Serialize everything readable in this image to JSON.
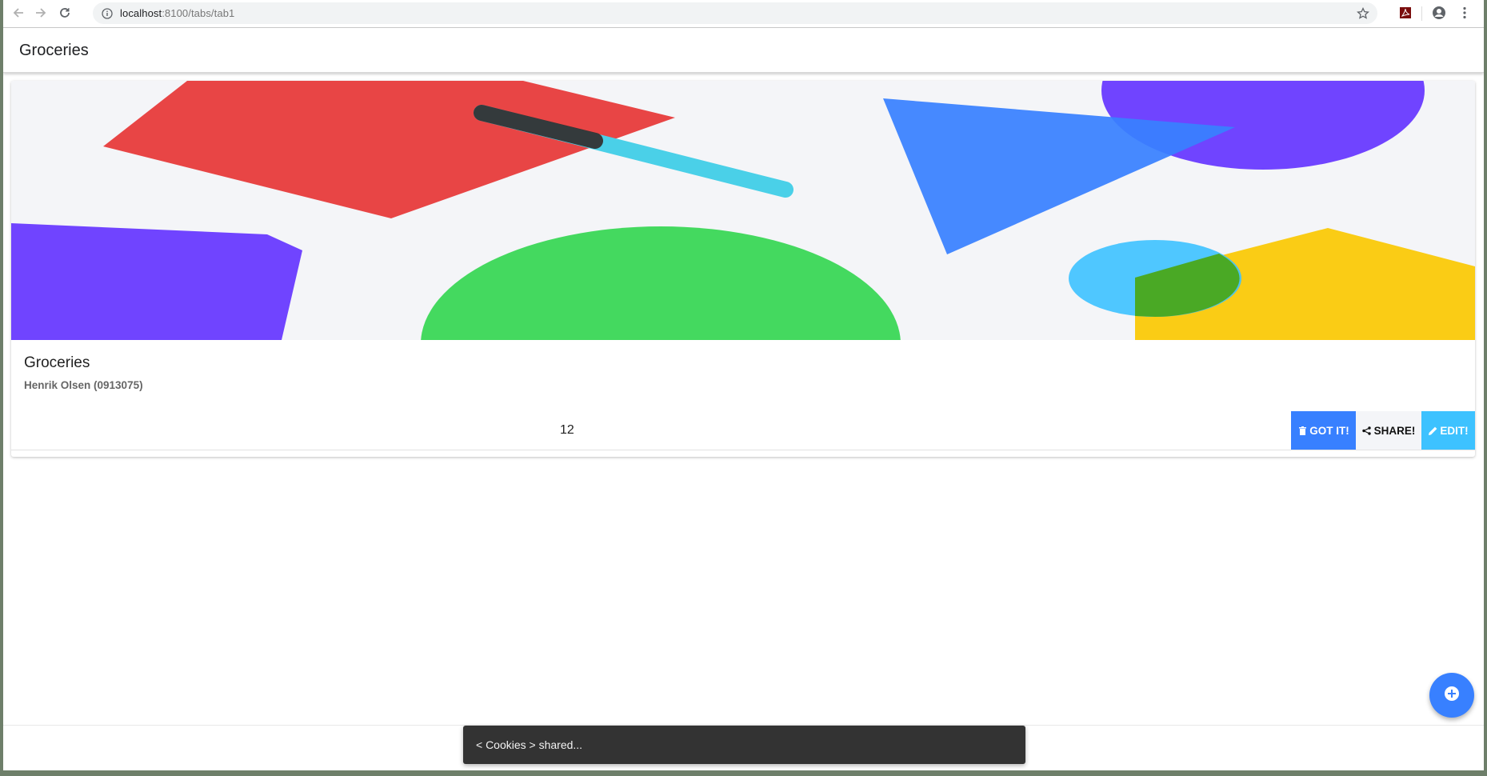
{
  "browser": {
    "url_host": "localhost",
    "url_rest": ":8100/tabs/tab1"
  },
  "header": {
    "title": "Groceries"
  },
  "card": {
    "title": "Groceries",
    "subtitle": "Henrik Olsen (0913075)",
    "count": "12",
    "buttons": {
      "got_it": "GOT IT!",
      "share": "SHARE!",
      "edit": "EDIT!"
    }
  },
  "toast": {
    "message": "< Cookies > shared..."
  },
  "colors": {
    "primary": "#3880ff",
    "secondary": "#3dc2ff",
    "light": "#f4f5f8",
    "toast_bg": "#333333"
  },
  "icons": {
    "back": "back-arrow-icon",
    "forward": "forward-arrow-icon",
    "reload": "reload-icon",
    "info": "info-icon",
    "star": "star-icon",
    "pdf": "pdf-extension-icon",
    "profile": "profile-icon",
    "menu": "kebab-menu-icon",
    "trash": "trash-icon",
    "share": "share-icon",
    "edit": "pencil-icon",
    "fab": "add-circle-icon"
  }
}
